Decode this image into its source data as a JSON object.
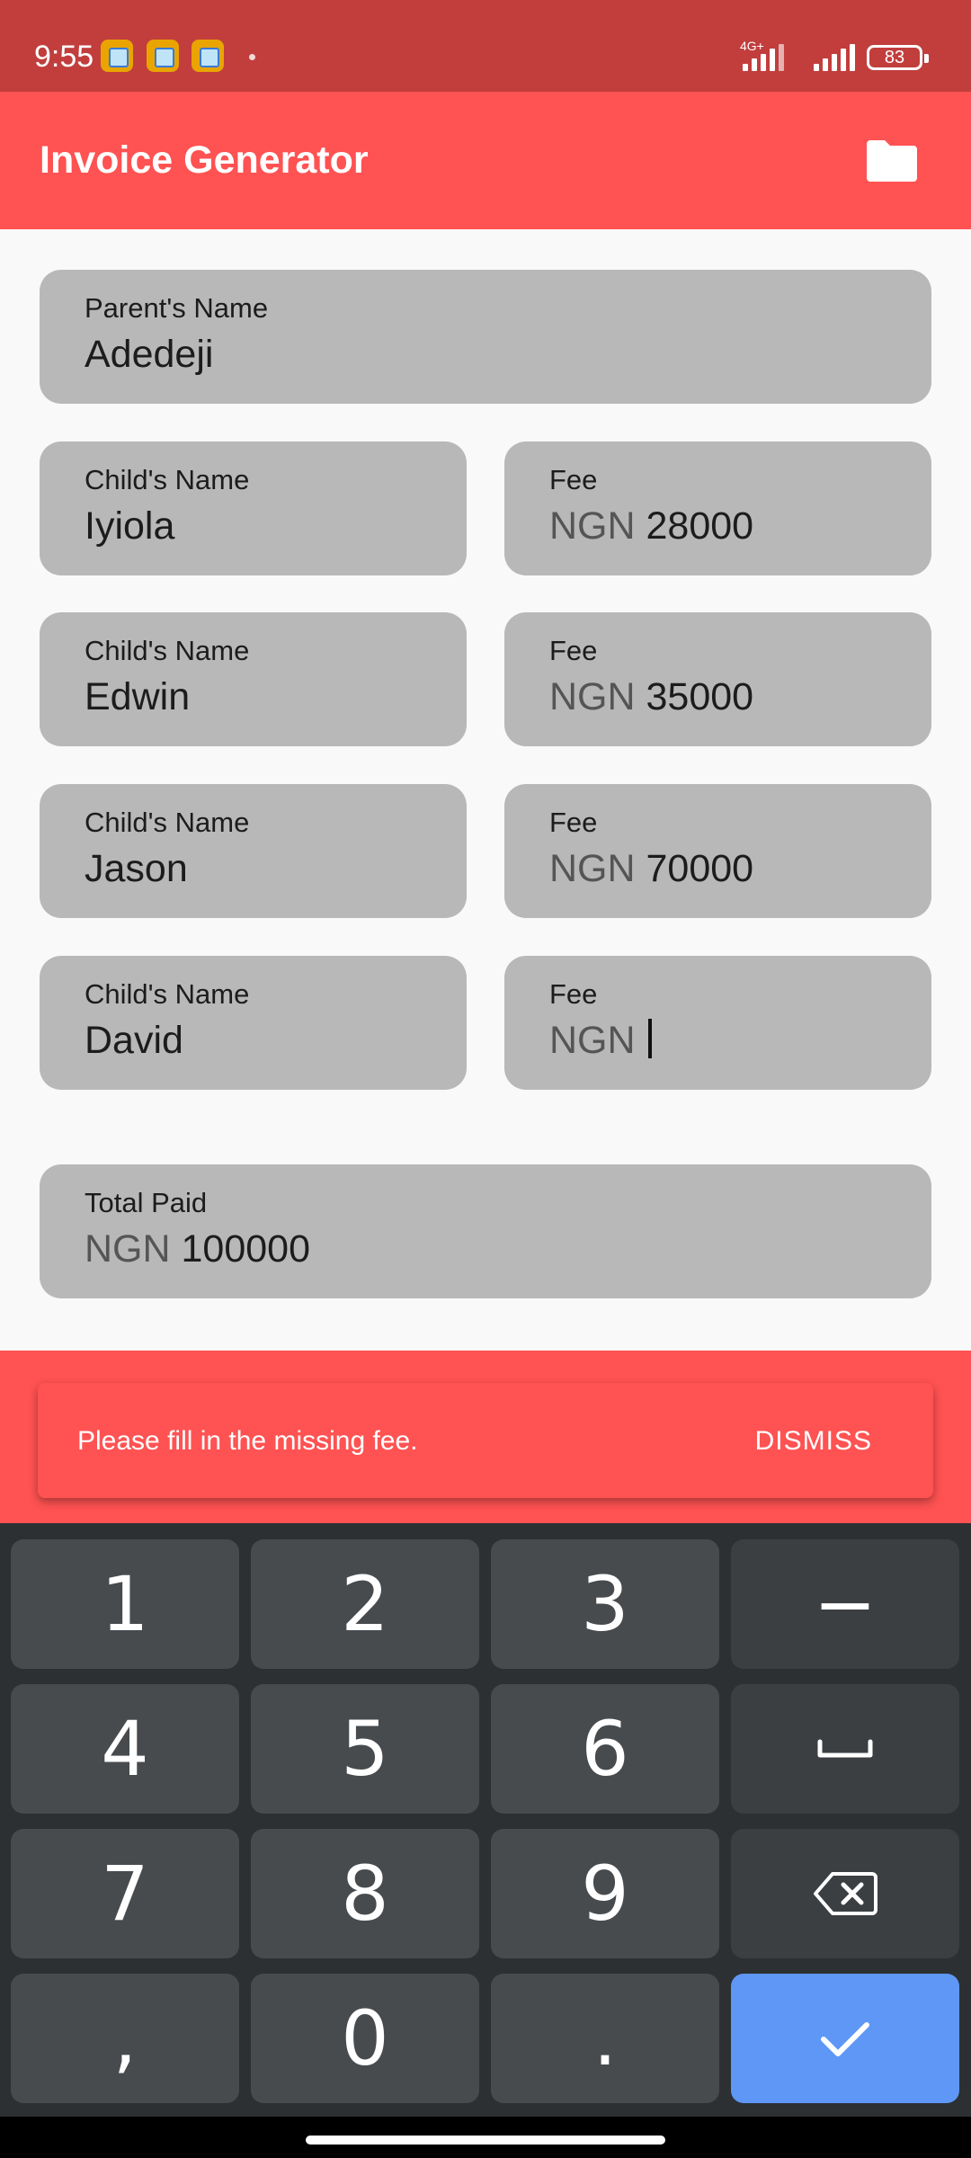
{
  "status_bar": {
    "time": "9:55",
    "network": "4G+",
    "battery": "83"
  },
  "app_bar": {
    "title": "Invoice Generator",
    "folder_icon": "folder-icon"
  },
  "form": {
    "parent": {
      "label": "Parent's Name",
      "value": "Adedeji"
    },
    "children": [
      {
        "name_label": "Child's Name",
        "name": "Iyiola",
        "fee_label": "Fee",
        "currency": "NGN",
        "fee": "28000"
      },
      {
        "name_label": "Child's Name",
        "name": "Edwin",
        "fee_label": "Fee",
        "currency": "NGN",
        "fee": "35000"
      },
      {
        "name_label": "Child's Name",
        "name": "Jason",
        "fee_label": "Fee",
        "currency": "NGN",
        "fee": "70000"
      },
      {
        "name_label": "Child's Name",
        "name": "David",
        "fee_label": "Fee",
        "currency": "NGN",
        "fee": ""
      }
    ],
    "total": {
      "label": "Total Paid",
      "currency": "NGN",
      "value": "100000"
    }
  },
  "snackbar": {
    "message": "Please fill in the missing fee.",
    "action": "DISMISS"
  },
  "keyboard": {
    "rows": [
      [
        "1",
        "2",
        "3",
        "−"
      ],
      [
        "4",
        "5",
        "6",
        "space-icon"
      ],
      [
        "7",
        "8",
        "9",
        "backspace-icon"
      ],
      [
        ",",
        "0",
        ".",
        "check-icon"
      ]
    ],
    "colors": {
      "key": "#474b4e",
      "function_key": "#3b3f42",
      "enter_key": "#5e97f6"
    }
  },
  "colors": {
    "accent": "#ff5252",
    "status_bar": "#c13e3d",
    "field": "#b8b8b8"
  }
}
